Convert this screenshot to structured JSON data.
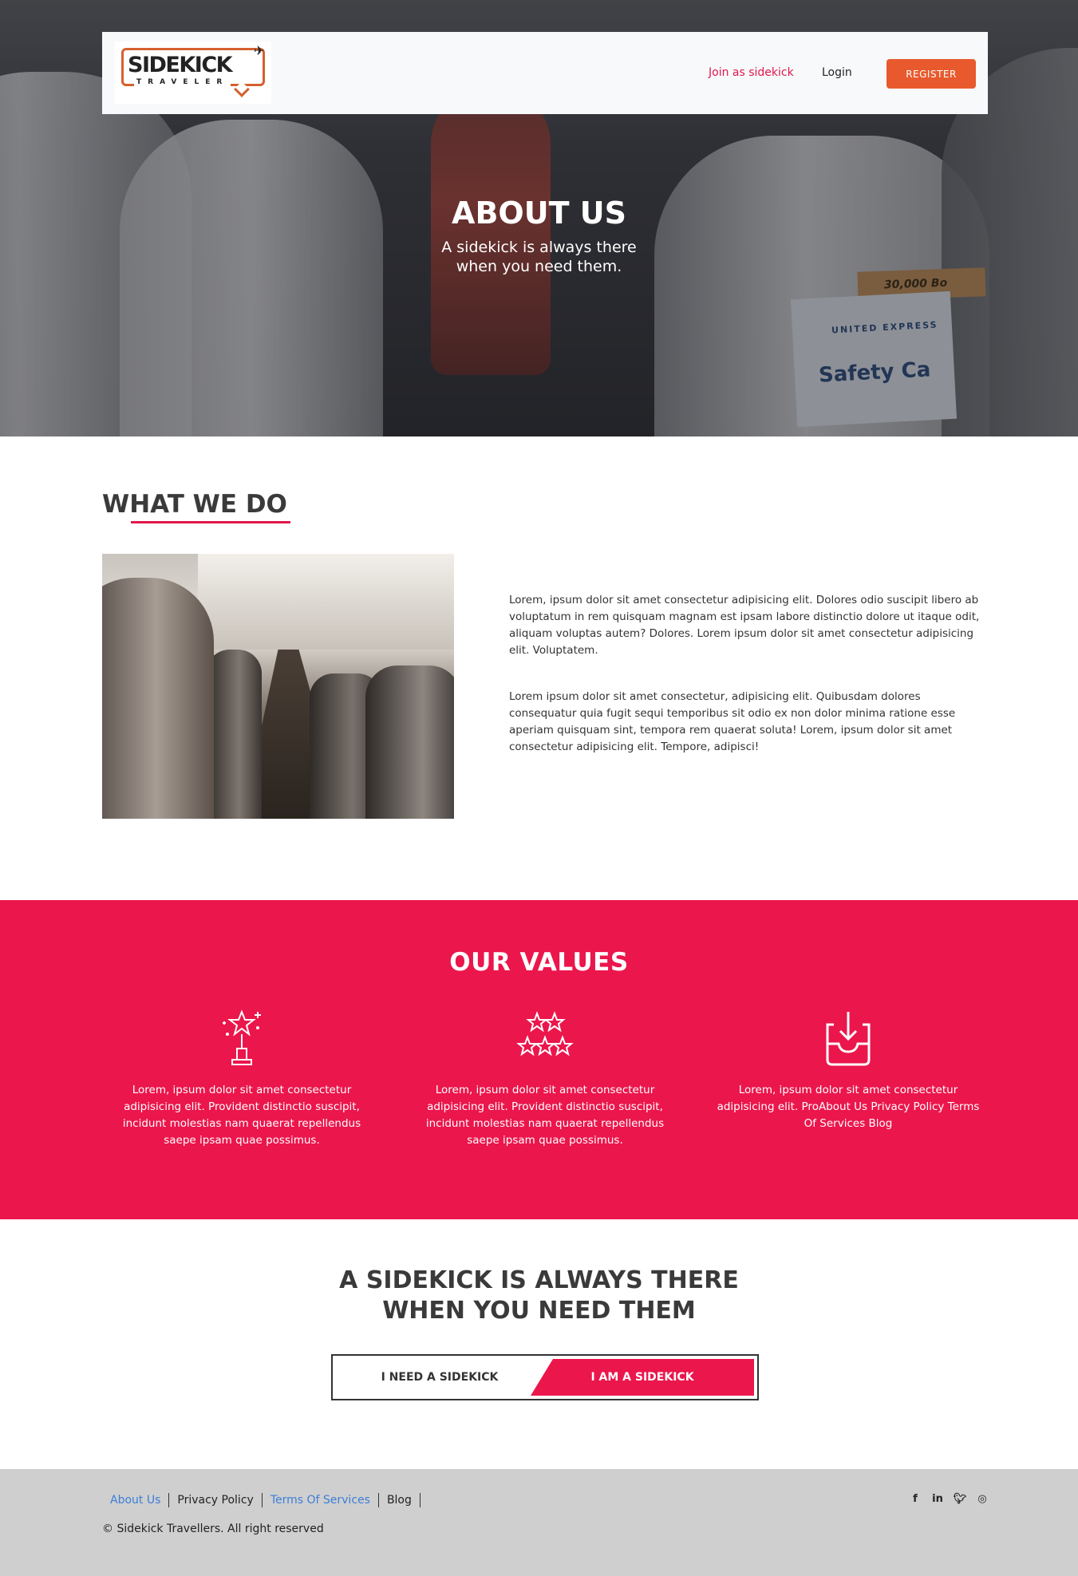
{
  "brand": {
    "name": "SIDEKICK",
    "tagline": "TRAVELER"
  },
  "nav": {
    "join_label": "Join as sidekick",
    "login_label": "Login",
    "register_label": "REGISTER"
  },
  "hero": {
    "title": "ABOUT US",
    "subtitle_line1": "A sidekick is always there",
    "subtitle_line2": "when you need them.",
    "photo_text": {
      "counter": "30,000 Bo",
      "airline": "UNITED EXPRESS",
      "card": "Safety Ca"
    }
  },
  "what_we_do": {
    "title": "WHAT WE DO",
    "paragraphs": [
      "Lorem, ipsum dolor sit amet consectetur adipisicing elit. Dolores odio suscipit libero ab voluptatum in rem quisquam magnam est ipsam labore distinctio dolore ut itaque odit, aliquam voluptas autem? Dolores. Lorem ipsum dolor sit amet consectetur adipisicing elit. Voluptatem.",
      "Lorem ipsum dolor sit amet consectetur, adipisicing elit. Quibusdam dolores consequatur quia fugit sequi temporibus sit odio ex non dolor minima ratione esse aperiam quisquam sint, tempora rem quaerat soluta! Lorem, ipsum dolor sit amet consectetur adipisicing elit. Tempore, adipisci!"
    ]
  },
  "values": {
    "title": "OUR VALUES",
    "items": [
      {
        "icon": "award-trophy-icon",
        "text": "Lorem, ipsum dolor sit amet consectetur adipisicing elit. Provident distinctio suscipit, incidunt molestias nam quaerat repellendus saepe ipsam quae possimus."
      },
      {
        "icon": "stars-rating-icon",
        "text": "Lorem, ipsum dolor sit amet consectetur adipisicing elit. Provident distinctio suscipit, incidunt molestias nam quaerat repellendus saepe ipsam quae possimus."
      },
      {
        "icon": "inbox-download-icon",
        "text": "Lorem, ipsum dolor sit amet consectetur adipisicing elit. ProAbout Us Privacy Policy Terms Of Services Blog"
      }
    ]
  },
  "cta": {
    "title_line1": "A SIDEKICK IS ALWAYS THERE",
    "title_line2": "WHEN YOU NEED THEM",
    "need_label": "I NEED A SIDEKICK",
    "am_label": "I AM A SIDEKICK"
  },
  "footer": {
    "links": [
      "About Us",
      "Privacy Policy",
      "Terms Of Services",
      "Blog"
    ],
    "copyright": "© Sidekick Travellers. All right reserved",
    "social": [
      "f",
      "in",
      "t",
      "ig"
    ]
  },
  "colors": {
    "accent": "#eb164c",
    "register": "#e85a2e",
    "link_blue": "#3c7ed6",
    "footer_bg": "#cfcfcf"
  }
}
